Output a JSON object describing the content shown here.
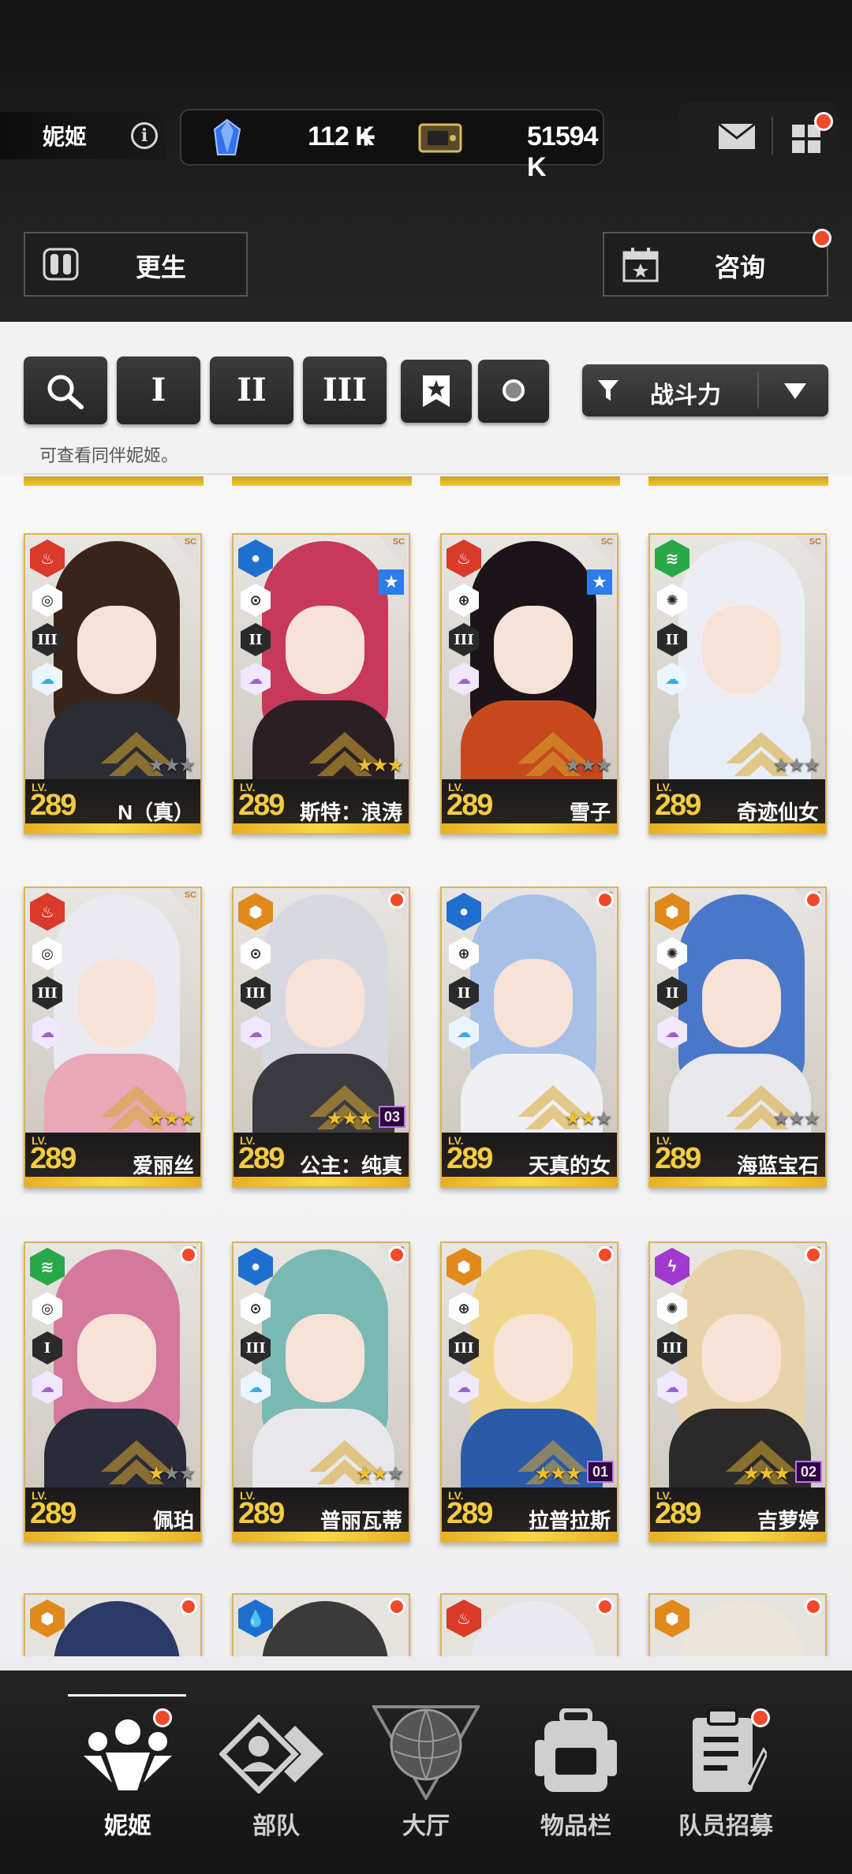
{
  "header": {
    "title": "妮姬",
    "currency_gems": "112 K",
    "currency_credits": "51594 K",
    "rebirth_label": "更生",
    "consult_label": "咨询"
  },
  "filter": {
    "sort_label": "战斗力",
    "hint": "可查看同伴妮姬。",
    "class_buttons": [
      "I",
      "II",
      "III"
    ]
  },
  "cards": [
    {
      "name": "N（真）",
      "level": "289",
      "stars": 0,
      "element": "fire",
      "class_roman": "III",
      "burst": ""
    },
    {
      "name": "斯特：浪涛",
      "level": "289",
      "stars": 3,
      "element": "water",
      "class_roman": "II",
      "burst": ""
    },
    {
      "name": "雪子",
      "level": "289",
      "stars": 0,
      "element": "fire",
      "class_roman": "III",
      "burst": ""
    },
    {
      "name": "奇迹仙女",
      "level": "289",
      "stars": 0,
      "element": "wind",
      "class_roman": "II",
      "burst": ""
    },
    {
      "name": "爱丽丝",
      "level": "289",
      "stars": 3,
      "element": "fire",
      "class_roman": "III",
      "burst": ""
    },
    {
      "name": "公主：纯真",
      "level": "289",
      "stars": 3,
      "element": "iron",
      "class_roman": "III",
      "burst": "03"
    },
    {
      "name": "天真的女",
      "level": "289",
      "stars": 2,
      "element": "water",
      "class_roman": "II",
      "burst": ""
    },
    {
      "name": "海蓝宝石",
      "level": "289",
      "stars": 0,
      "element": "iron",
      "class_roman": "II",
      "burst": ""
    },
    {
      "name": "佩珀",
      "level": "289",
      "stars": 1,
      "element": "wind",
      "class_roman": "I",
      "burst": ""
    },
    {
      "name": "普丽瓦蒂",
      "level": "289",
      "stars": 2,
      "element": "water",
      "class_roman": "III",
      "burst": ""
    },
    {
      "name": "拉普拉斯",
      "level": "289",
      "stars": 3,
      "element": "iron",
      "class_roman": "III",
      "burst": "01"
    },
    {
      "name": "吉萝婷",
      "level": "289",
      "stars": 3,
      "element": "electric",
      "class_roman": "III",
      "burst": "02"
    }
  ],
  "nav": [
    {
      "label": "妮姬",
      "active": true
    },
    {
      "label": "部队",
      "active": false
    },
    {
      "label": "大厅",
      "active": false
    },
    {
      "label": "物品栏",
      "active": false
    },
    {
      "label": "队员招募",
      "active": false
    }
  ],
  "colors": {
    "fire": "#d93a2a",
    "water": "#1f6fd0",
    "wind": "#29a84a",
    "iron": "#e08a1c",
    "electric": "#a23ad0",
    "gold": "#f0c030",
    "notify": "#f04a2a"
  }
}
